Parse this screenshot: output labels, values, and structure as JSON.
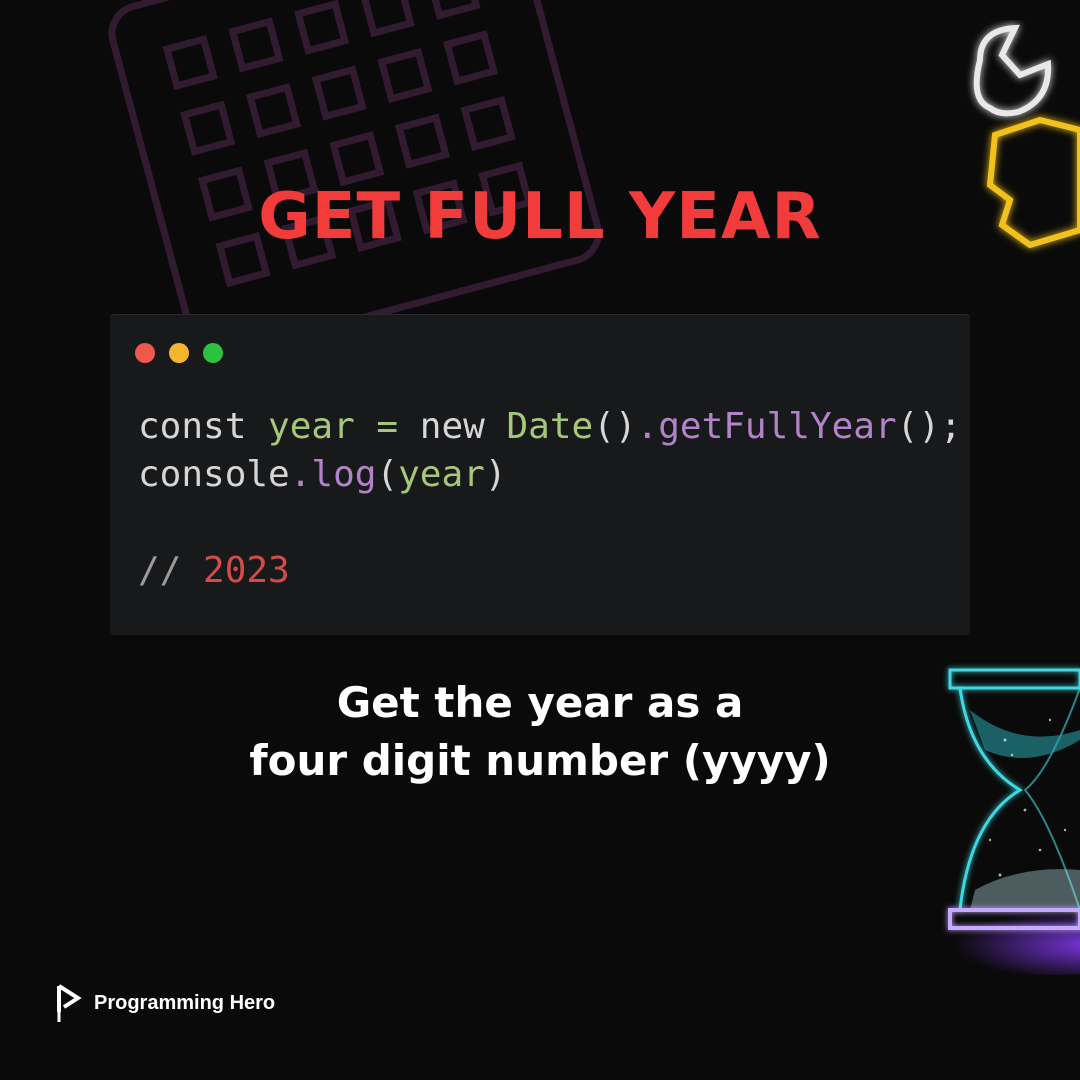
{
  "title": "GET FULL YEAR",
  "code_window": {
    "traffic_lights": [
      "#f0574f",
      "#f6b52f",
      "#2cc23f"
    ],
    "lines": [
      [
        {
          "text": "const ",
          "color": "#d6d6d6"
        },
        {
          "text": "year",
          "color": "#a6c77a"
        },
        {
          "text": " = ",
          "color": "#a6c77a"
        },
        {
          "text": "new ",
          "color": "#d6d6d6"
        },
        {
          "text": "Date",
          "color": "#a6c77a"
        },
        {
          "text": "()",
          "color": "#d6d6d6"
        },
        {
          "text": ".getFullYear",
          "color": "#b383c9"
        },
        {
          "text": "();",
          "color": "#d6d6d6"
        }
      ],
      [
        {
          "text": "console",
          "color": "#d6d6d6"
        },
        {
          "text": ".log",
          "color": "#b383c9"
        },
        {
          "text": "(",
          "color": "#d6d6d6"
        },
        {
          "text": "year",
          "color": "#a6c77a"
        },
        {
          "text": ")",
          "color": "#d6d6d6"
        }
      ],
      [],
      [
        {
          "text": "// ",
          "color": "#9a9a9a"
        },
        {
          "text": "2023",
          "color": "#d64a4a"
        }
      ]
    ]
  },
  "description": {
    "line1": "Get the year as a",
    "line2": "four digit number (yyyy)"
  },
  "brand": {
    "name": "Programming Hero",
    "icon": "programming-hero-logo-icon"
  },
  "decorations": {
    "calendar_icon": "calendar-icon",
    "wrench_icon": "wrench-icon",
    "hourglass_icon": "hourglass-icon"
  },
  "colors": {
    "title": "#f23c3c",
    "background": "#0a0a0a",
    "code_background": "#18191b"
  }
}
